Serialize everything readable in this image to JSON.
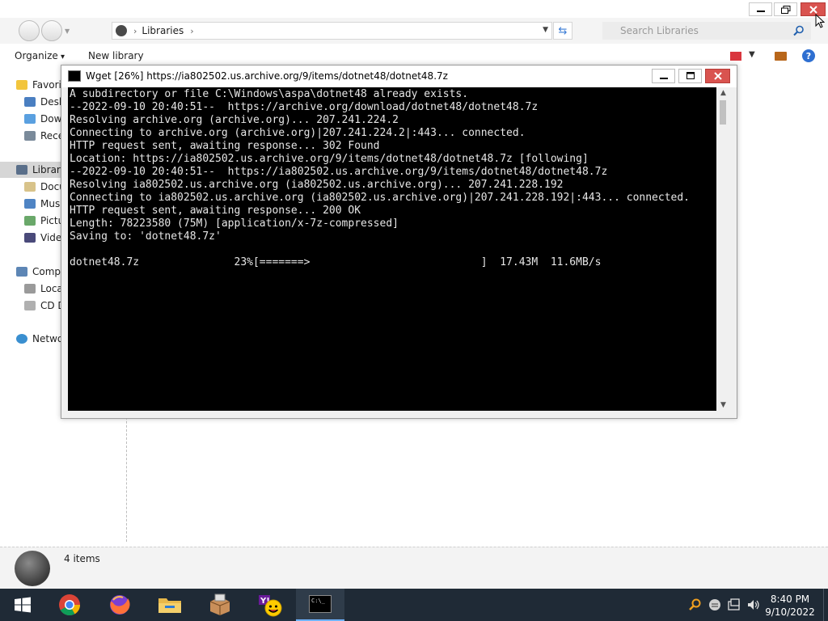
{
  "explorer": {
    "address": {
      "crumb": "Libraries"
    },
    "search": {
      "placeholder": "Search Libraries"
    },
    "toolbar": {
      "organize_label": "Organize",
      "new_library_label": "New library",
      "help_label": "?"
    },
    "nav": {
      "favorites": "Favorites",
      "desktop": "Desktop",
      "downloads": "Downloads",
      "recent": "Recent Places",
      "libraries": "Libraries",
      "documents": "Documents",
      "music": "Music",
      "pictures": "Pictures",
      "videos": "Videos",
      "computer": "Computer",
      "local_disk": "Local Disk (C:)",
      "cd_drive": "CD Drive (D:)",
      "network": "Network"
    },
    "status": {
      "item_count": "4 items"
    }
  },
  "console": {
    "title": "Wget [26%] https://ia802502.us.archive.org/9/items/dotnet48/dotnet48.7z",
    "lines": [
      "A subdirectory or file C:\\Windows\\aspa\\dotnet48 already exists.",
      "--2022-09-10 20:40:51--  https://archive.org/download/dotnet48/dotnet48.7z",
      "Resolving archive.org (archive.org)... 207.241.224.2",
      "Connecting to archive.org (archive.org)|207.241.224.2|:443... connected.",
      "HTTP request sent, awaiting response... 302 Found",
      "Location: https://ia802502.us.archive.org/9/items/dotnet48/dotnet48.7z [following]",
      "--2022-09-10 20:40:51--  https://ia802502.us.archive.org/9/items/dotnet48/dotnet48.7z",
      "Resolving ia802502.us.archive.org (ia802502.us.archive.org)... 207.241.228.192",
      "Connecting to ia802502.us.archive.org (ia802502.us.archive.org)|207.241.228.192|:443... connected.",
      "HTTP request sent, awaiting response... 200 OK",
      "Length: 78223580 (75M) [application/x-7z-compressed]",
      "Saving to: 'dotnet48.7z'",
      "",
      "dotnet48.7z               23%[=======>                           ]  17.43M  11.6MB/s"
    ]
  },
  "taskbar": {
    "apps": [
      "windows-start",
      "chrome",
      "firefox",
      "file-explorer",
      "app-installer",
      "yahoo-messenger",
      "command-prompt"
    ],
    "console_icon_text": "C:\\_",
    "clock": {
      "time": "8:40 PM",
      "date": "9/10/2022"
    }
  },
  "colors": {
    "taskbar": "#1f2a36",
    "close": "#d9534f",
    "console_bg": "#000000",
    "console_text": "#e6e6e6",
    "accent": "#6fb3ff"
  }
}
